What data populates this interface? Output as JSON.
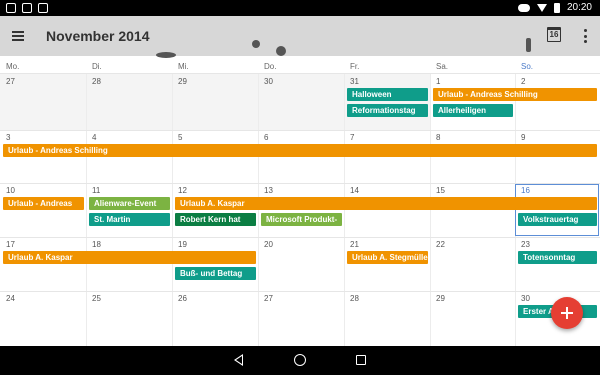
{
  "status_bar": {
    "time": "20:20"
  },
  "header": {
    "title": "November 2014",
    "today_icon_day": "16"
  },
  "weekdays": [
    "Mo.",
    "Di.",
    "Mi.",
    "Do.",
    "Fr.",
    "Sa.",
    "So."
  ],
  "weeks": [
    [
      "27",
      "28",
      "29",
      "30",
      "31",
      "1",
      "2"
    ],
    [
      "3",
      "4",
      "5",
      "6",
      "7",
      "8",
      "9"
    ],
    [
      "10",
      "11",
      "12",
      "13",
      "14",
      "15",
      "16"
    ],
    [
      "17",
      "18",
      "19",
      "20",
      "21",
      "22",
      "23"
    ],
    [
      "24",
      "25",
      "26",
      "27",
      "28",
      "29",
      "30"
    ]
  ],
  "today": "16",
  "events": [
    {
      "title": "Halloween",
      "color": "#0f9d8a",
      "week": 0,
      "day": 4,
      "span": 1,
      "row": 0
    },
    {
      "title": "Reformationstag",
      "color": "#0f9d8a",
      "week": 0,
      "day": 4,
      "span": 1,
      "row": 1
    },
    {
      "title": "Urlaub - Andreas Schilling",
      "color": "#f09300",
      "week": 0,
      "day": 5,
      "span": 2,
      "row": 0
    },
    {
      "title": "Allerheiligen",
      "color": "#0f9d8a",
      "week": 0,
      "day": 5,
      "span": 1,
      "row": 1
    },
    {
      "title": "Urlaub - Andreas Schilling",
      "color": "#f09300",
      "week": 1,
      "day": 0,
      "span": 7,
      "row": 0
    },
    {
      "title": "Urlaub - Andreas",
      "color": "#f09300",
      "week": 2,
      "day": 0,
      "span": 1,
      "row": 0
    },
    {
      "title": "Alienware-Event",
      "color": "#7cb342",
      "week": 2,
      "day": 1,
      "span": 1,
      "row": 0
    },
    {
      "title": "St. Martin",
      "color": "#0f9d8a",
      "week": 2,
      "day": 1,
      "span": 1,
      "row": 1
    },
    {
      "title": "Urlaub A. Kaspar",
      "color": "#f09300",
      "week": 2,
      "day": 2,
      "span": 5,
      "row": 0
    },
    {
      "title": "Robert Kern hat",
      "color": "#0b7e43",
      "week": 2,
      "day": 2,
      "span": 1,
      "row": 1
    },
    {
      "title": "Microsoft Produkt-",
      "color": "#7cb342",
      "week": 2,
      "day": 3,
      "span": 1,
      "row": 1
    },
    {
      "title": "Volkstrauertag",
      "color": "#0f9d8a",
      "week": 2,
      "day": 6,
      "span": 1,
      "row": 1
    },
    {
      "title": "Urlaub A. Kaspar",
      "color": "#f09300",
      "week": 3,
      "day": 0,
      "span": 3,
      "row": 0
    },
    {
      "title": "Buß- und Bettag",
      "color": "#0f9d8a",
      "week": 3,
      "day": 2,
      "span": 1,
      "row": 1
    },
    {
      "title": "Urlaub A. Stegmüller",
      "color": "#f09300",
      "week": 3,
      "day": 4,
      "span": 1,
      "row": 0
    },
    {
      "title": "Totensonntag",
      "color": "#0f9d8a",
      "week": 3,
      "day": 6,
      "span": 1,
      "row": 0
    },
    {
      "title": "Erster Advent",
      "color": "#0f9d8a",
      "week": 4,
      "day": 6,
      "span": 1,
      "row": 0
    }
  ],
  "fab": {
    "icon": "plus-icon"
  },
  "nav": {
    "icons": [
      "back-icon",
      "home-icon",
      "recents-icon"
    ]
  }
}
